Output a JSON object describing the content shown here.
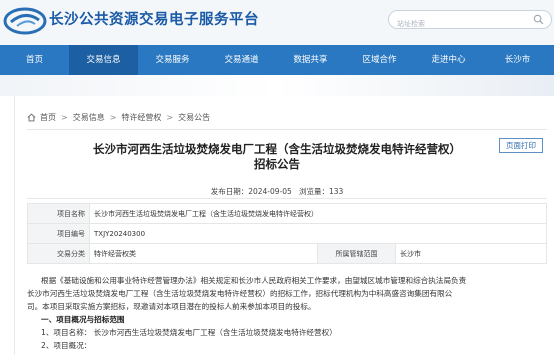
{
  "header": {
    "site_title": "长沙公共资源交易电子服务平台",
    "search_placeholder": "站址检索",
    "icons": {
      "logo": "logo-mark",
      "search": "search-icon"
    }
  },
  "nav": {
    "items": [
      "首页",
      "交易信息",
      "交易服务",
      "交易通道",
      "数据共享",
      "区域合作",
      "走进中心",
      "长沙市"
    ],
    "active": "交易信息"
  },
  "breadcrumb": [
    "首页",
    "交易信息",
    "特许经营权",
    "交易公告"
  ],
  "article": {
    "title_line1": "长沙市河西生活垃圾焚烧发电厂工程（含生活垃圾焚烧发电特许经营权）",
    "title_line2": "招标公告",
    "print_label": "页面打印",
    "publish_label": "发布日期：",
    "publish_date": "2024-09-05",
    "views_label": "浏览量：",
    "views": "133"
  },
  "info_table": {
    "project_name_label": "项目名称",
    "project_name": "长沙市河西生活垃圾焚烧发电厂工程（含生活垃圾焚烧发电特许经营权）",
    "project_no_label": "项目编号",
    "project_no": "TXJY20240300",
    "category_label": "交易分类",
    "category": "特许经营权类",
    "region_label": "所属管辖范围",
    "region": "长沙市"
  },
  "body": {
    "para1_line1": "根据《基础设施和公用事业特许经营管理办法》相关规定和长沙市人民政府相关工作要求，由望城区城市管理和综合执法局负责",
    "para1_line2": "长沙市河西生活垃圾焚烧发电厂工程（含生活垃圾焚烧发电特许经营权）的招标工作，招标代理机构为中科高盛咨询集团有限公",
    "para1_line3": "司。本项目采取实施方案招标，现邀请对本项目潜在的投标人前来参加本项目的投标。",
    "section1": "一、项目概况与招标范围",
    "item1": "1、项目名称：  长沙市河西生活垃圾焚烧发电厂工程（含生活垃圾焚烧发电特许经营权）",
    "item2": "2、项目概况："
  }
}
